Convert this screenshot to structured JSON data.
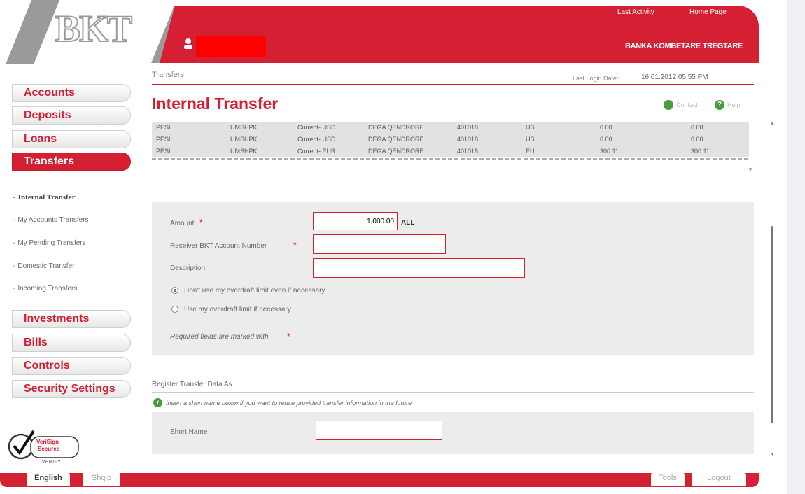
{
  "brand": {
    "logo": "BKT",
    "bank_name": "BANKA KOMBETARE TREGTARE"
  },
  "header": {
    "last_activity": "Last Activity",
    "home_page": "Home Page"
  },
  "breadcrumb": "Transfers",
  "last_login": {
    "label": "Last Login Date:",
    "value": "16.01.2012 05:55 PM"
  },
  "page_title": "Internal Transfer",
  "actions": {
    "contact": "Contact",
    "help": "Help"
  },
  "sidebar": {
    "items": [
      {
        "label": "Accounts"
      },
      {
        "label": "Deposits"
      },
      {
        "label": "Loans"
      },
      {
        "label": "Transfers"
      },
      {
        "label": "Investments"
      },
      {
        "label": "Bills"
      },
      {
        "label": "Controls"
      },
      {
        "label": "Security Settings"
      }
    ],
    "sub_items": [
      {
        "label": "Internal Transfer"
      },
      {
        "label": "My Accounts Transfers"
      },
      {
        "label": "My Pending Transfers"
      },
      {
        "label": "Domestic Transfer"
      },
      {
        "label": "Incoming Transfers"
      }
    ]
  },
  "accounts_table": {
    "rows": [
      [
        "PESI",
        "UMSHPK ...",
        "Current- USD",
        "DEGA QENDRORE ...",
        "401018",
        "US...",
        "0.00",
        "0.00"
      ],
      [
        "PESI",
        "UMSHPK",
        "Current- USD",
        "DEGA QENDRORE ...",
        "401018",
        "US...",
        "0.00",
        "0.00"
      ],
      [
        "PESI",
        "UMSHPK",
        "Current- EUR",
        "DEGA QENDRORE ...",
        "401018",
        "EU...",
        "300.11",
        "300.11"
      ]
    ]
  },
  "form": {
    "amount_label": "Amount",
    "amount_value": "1,000.00",
    "currency": "ALL",
    "receiver_label": "Receiver BKT Account Number",
    "receiver_value": "",
    "description_label": "Description",
    "description_value": "",
    "overdraft_no": "Don't use my overdraft limit even if necessary",
    "overdraft_yes": "Use my overdraft limit if necessary",
    "required_note": "Required fields are marked with"
  },
  "register": {
    "title": "Register Transfer Data As",
    "info": "Insert a short name below if you want to reuse provided transfer information in the future",
    "short_name_label": "Short Name",
    "short_name_value": ""
  },
  "badge": {
    "line1": "VeriSign",
    "line2": "Secured",
    "line3": "VERIFY"
  },
  "footer": {
    "english": "English",
    "shqip": "Shqip",
    "tools": "Tools",
    "logout": "Logout"
  },
  "colors": {
    "brand_red": "#d51f33",
    "panel_gray": "#ececec"
  }
}
